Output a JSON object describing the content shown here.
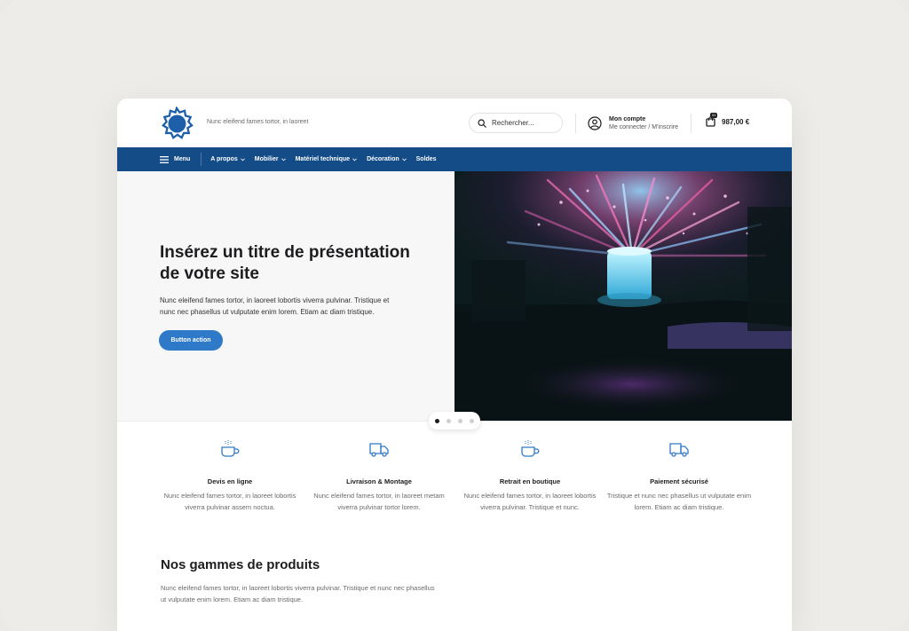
{
  "header": {
    "tagline": "Nunc eleifend fames tortor, in laoreet",
    "search_placeholder": "Rechercher...",
    "account_title": "Mon compte",
    "account_sub": "Me connecter / M'inscrire",
    "cart_badge": "00",
    "cart_amount": "987,00 €"
  },
  "nav": {
    "menu_label": "Menu",
    "items": [
      {
        "label": "A propos",
        "dropdown": true
      },
      {
        "label": "Mobilier",
        "dropdown": true
      },
      {
        "label": "Matériel technique",
        "dropdown": true
      },
      {
        "label": "Décoration",
        "dropdown": true
      },
      {
        "label": "Soldes",
        "dropdown": false
      }
    ]
  },
  "hero": {
    "title": "Insérez un titre de présentation de votre site",
    "text": "Nunc eleifend fames tortor, in laoreet lobortis viverra pulvinar. Tristique et nunc nec phasellus ut vulputate enim lorem. Etiam ac diam tristique.",
    "button": "Button action",
    "slide_count": 4,
    "active_slide": 1
  },
  "features": [
    {
      "icon": "cup-icon",
      "title": "Devis en ligne",
      "text": "Nunc eleifend fames tortor, in laoreet lobortis viverra pulvinar assem noctua."
    },
    {
      "icon": "truck-icon",
      "title": "Livraison & Montage",
      "text": "Nunc eleifend fames tortor, in laoreet metam viverra pulvinar tortor lorem."
    },
    {
      "icon": "cup-icon",
      "title": "Retrait en boutique",
      "text": "Nunc eleifend fames tortor, in laoreet lobortis viverra pulvinar. Tristique et nunc."
    },
    {
      "icon": "truck-icon",
      "title": "Paiement sécurisé",
      "text": "Tristique et nunc nec phasellus ut vulputate enim lorem. Etiam ac diam tristique."
    }
  ],
  "gammes": {
    "title": "Nos gammes de produits",
    "text": "Nunc eleifend fames tortor, in laoreet lobortis viverra pulvinar. Tristique et nunc nec phasellus ut vulputate enim lorem. Etiam ac diam tristique."
  },
  "colors": {
    "nav": "#134c87",
    "accent": "#2f7ac8",
    "logo": "#1d5fa8"
  }
}
